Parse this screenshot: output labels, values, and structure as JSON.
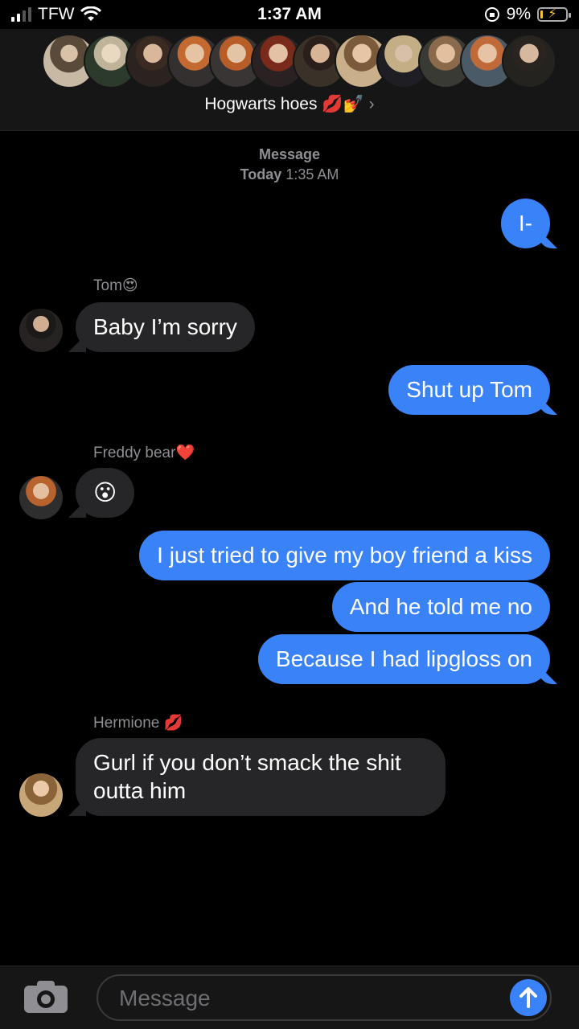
{
  "status_bar": {
    "carrier": "TFW",
    "time": "1:37 AM",
    "battery": "9%"
  },
  "header": {
    "group_name": "Hogwarts hoes 💋💅",
    "chevron": "›"
  },
  "conversation": {
    "label": "Message",
    "timestamp_day": "Today",
    "timestamp_time": "1:35 AM"
  },
  "messages": [
    {
      "dir": "out",
      "text": "I-"
    },
    {
      "dir": "in",
      "sender": "Tom😍",
      "text": "Baby I’m sorry"
    },
    {
      "dir": "out",
      "text": "Shut up Tom"
    },
    {
      "dir": "in",
      "sender": "Freddy bear❤️",
      "text": "😮"
    },
    {
      "dir": "out",
      "text": "I just tried to give my boy friend a kiss"
    },
    {
      "dir": "out",
      "text": "And he told me no"
    },
    {
      "dir": "out",
      "text": "Because I had lipgloss on"
    },
    {
      "dir": "in",
      "sender": "Hermione 💋",
      "text": "Gurl if you don’t smack the shit",
      "text2": "outta him"
    }
  ],
  "input": {
    "placeholder": "Message"
  },
  "colors": {
    "outgoing_bubble": "#3a82f7",
    "incoming_bubble": "#262628",
    "secondary_text": "#8e8e93"
  }
}
